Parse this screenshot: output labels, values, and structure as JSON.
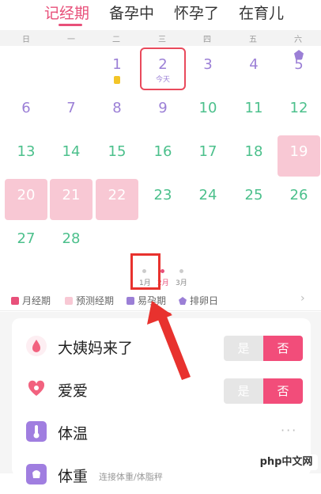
{
  "tabs": [
    {
      "label": "记经期",
      "active": true
    },
    {
      "label": "备孕中",
      "active": false
    },
    {
      "label": "怀孕了",
      "active": false
    },
    {
      "label": "在育儿",
      "active": false
    }
  ],
  "weekdays": [
    "日",
    "一",
    "二",
    "三",
    "四",
    "五",
    "六"
  ],
  "calendar": {
    "today_label": "今天",
    "row1": [
      "1",
      "2",
      "3",
      "4",
      "5"
    ],
    "row2": [
      "6",
      "7",
      "8",
      "9",
      "10",
      "11",
      "12"
    ],
    "row3": [
      "13",
      "14",
      "15",
      "16",
      "17",
      "18",
      "19"
    ],
    "row4": [
      "20",
      "21",
      "22",
      "23",
      "24",
      "25",
      "26"
    ],
    "row5": [
      "27",
      "28"
    ]
  },
  "months": [
    "1月",
    "2月",
    "3月"
  ],
  "legend": [
    "月经期",
    "预测经期",
    "易孕期",
    "排卵日"
  ],
  "records": [
    {
      "label": "大姨妈来了",
      "yes": "是",
      "no": "否"
    },
    {
      "label": "爱爱",
      "yes": "是",
      "no": "否"
    },
    {
      "label": "体温",
      "more": "···"
    },
    {
      "label": "体重",
      "sub": "连接体重/体脂秤"
    }
  ],
  "watermark": "php中文网",
  "colors": {
    "accent": "#e8507a",
    "purple": "#9b7fd6",
    "green": "#4cc08c",
    "period": "#f8c8d4",
    "annotation": "#e8322e"
  }
}
